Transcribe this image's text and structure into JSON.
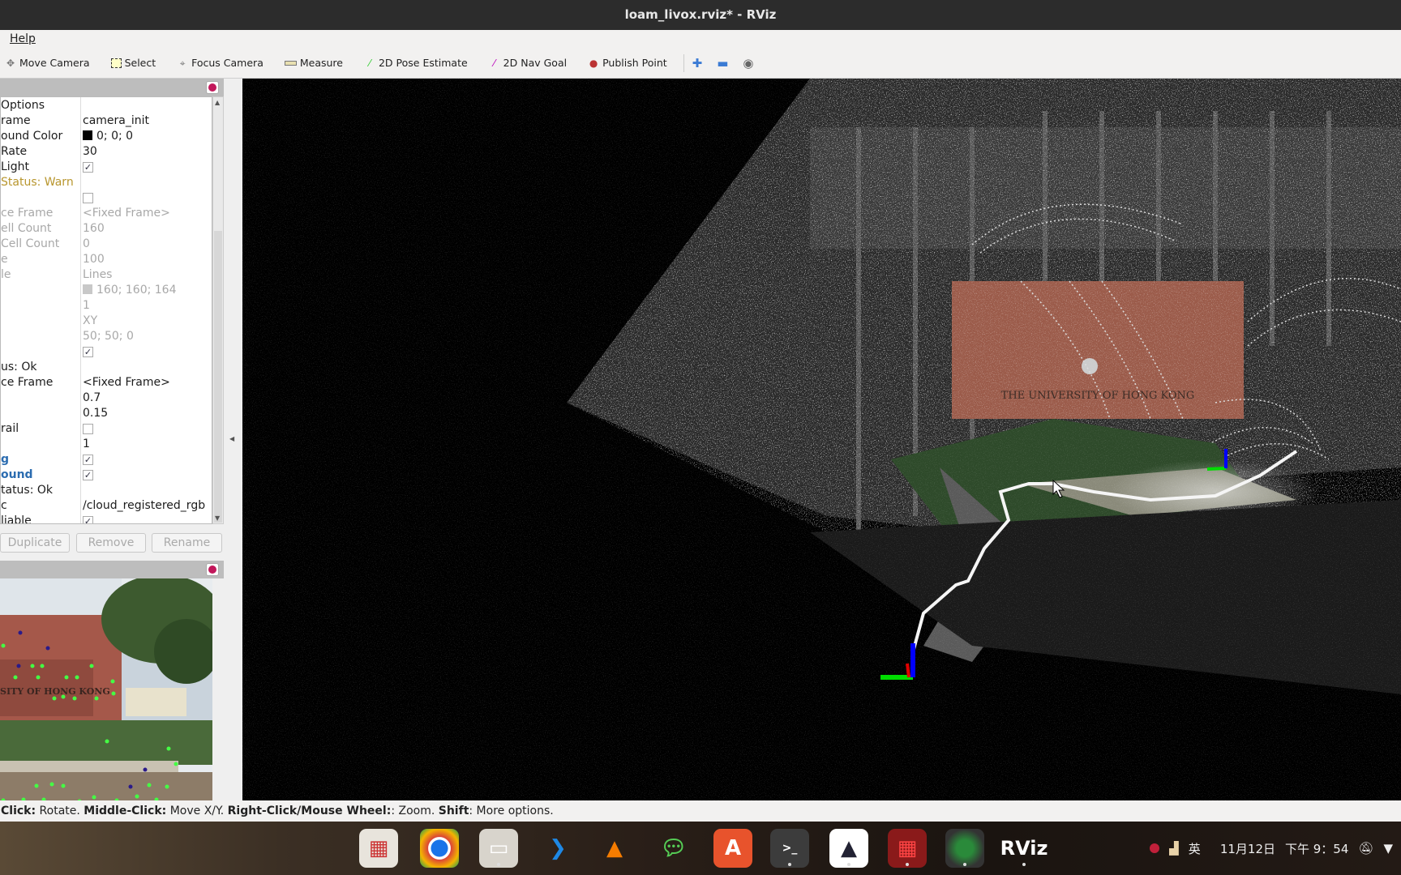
{
  "window": {
    "title": "loam_livox.rviz* - RViz"
  },
  "menu": {
    "help": "Help"
  },
  "toolbar": {
    "tools": [
      {
        "label": "Move Camera",
        "icon": "move-camera-icon"
      },
      {
        "label": "Select",
        "icon": "select-icon"
      },
      {
        "label": "Focus Camera",
        "icon": "focus-camera-icon"
      },
      {
        "label": "Measure",
        "icon": "ruler-icon"
      },
      {
        "label": "2D Pose Estimate",
        "icon": "green-arrow-icon"
      },
      {
        "label": "2D Nav Goal",
        "icon": "magenta-arrow-icon"
      },
      {
        "label": "Publish Point",
        "icon": "map-pin-icon"
      }
    ]
  },
  "displays": {
    "rows": [
      {
        "label": "Options",
        "type": "text",
        "value": ""
      },
      {
        "label": "rame",
        "type": "text",
        "value": "camera_init"
      },
      {
        "label": "ound Color",
        "type": "swatch",
        "value": "0; 0; 0",
        "color": "#000000"
      },
      {
        "label": "Rate",
        "type": "text",
        "value": "30"
      },
      {
        "label": " Light",
        "type": "check",
        "checked": true
      },
      {
        "label": "Status: Warn",
        "type": "text",
        "value": "",
        "style": "warn"
      },
      {
        "label": "",
        "type": "check",
        "checked": false
      },
      {
        "label": "ce Frame",
        "type": "text",
        "value": "<Fixed Frame>",
        "style": "dis"
      },
      {
        "label": "ell Count",
        "type": "text",
        "value": "160",
        "style": "dis"
      },
      {
        "label": " Cell Count",
        "type": "text",
        "value": "0",
        "style": "dis"
      },
      {
        "label": "e",
        "type": "text",
        "value": "100",
        "style": "dis"
      },
      {
        "label": "le",
        "type": "text",
        "value": "Lines",
        "style": "dis"
      },
      {
        "label": "",
        "type": "swatch",
        "value": "160; 160; 164",
        "color": "#c8c8c8",
        "style": "dis"
      },
      {
        "label": "",
        "type": "text",
        "value": "1",
        "style": "dis"
      },
      {
        "label": "",
        "type": "text",
        "value": "XY",
        "style": "dis"
      },
      {
        "label": "",
        "type": "text",
        "value": "50; 50; 0",
        "style": "dis"
      },
      {
        "label": "",
        "type": "check",
        "checked": true
      },
      {
        "label": "us: Ok",
        "type": "text",
        "value": ""
      },
      {
        "label": "ce Frame",
        "type": "text",
        "value": "<Fixed Frame>"
      },
      {
        "label": "",
        "type": "text",
        "value": "0.7"
      },
      {
        "label": "",
        "type": "text",
        "value": "0.15"
      },
      {
        "label": "rail",
        "type": "check",
        "checked": false
      },
      {
        "label": "",
        "type": "text",
        "value": "1"
      },
      {
        "label": "g",
        "type": "check",
        "checked": true,
        "style": "blue"
      },
      {
        "label": "ound",
        "type": "check",
        "checked": true,
        "style": "blue"
      },
      {
        "label": "tatus: Ok",
        "type": "text",
        "value": ""
      },
      {
        "label": "c",
        "type": "text",
        "value": "/cloud_registered_rgb"
      },
      {
        "label": "liable",
        "type": "check",
        "checked": true
      }
    ],
    "buttons": {
      "duplicate": "Duplicate",
      "remove": "Remove",
      "rename": "Rename"
    }
  },
  "image_panel": {
    "sign_text": "SITY OF HONG KONG"
  },
  "viewport": {
    "sign_text": "THE UNIVERSITY OF HONG KONG"
  },
  "status": {
    "k1": "Click:",
    "v1": " Rotate. ",
    "k2": "Middle-Click:",
    "v2": " Move X/Y. ",
    "k3": "Right-Click/Mouse Wheel:",
    "v3": ": Zoom. ",
    "k4": "Shift",
    "v4": ": More options."
  },
  "taskbar": {
    "apps": [
      {
        "name": "app-grid",
        "label": ""
      },
      {
        "name": "chrome",
        "label": ""
      },
      {
        "name": "files",
        "label": ""
      },
      {
        "name": "vscode",
        "label": ""
      },
      {
        "name": "vlc",
        "label": ""
      },
      {
        "name": "wechat",
        "label": ""
      },
      {
        "name": "app-store",
        "label": ""
      },
      {
        "name": "terminal",
        "label": ">_"
      },
      {
        "name": "cat-app",
        "label": ""
      },
      {
        "name": "rqt",
        "label": ""
      },
      {
        "name": "camera",
        "label": ""
      },
      {
        "name": "rviz",
        "label": "RViz"
      }
    ],
    "ime": "英",
    "date": "11月12日",
    "time": "下午 9：54"
  },
  "colors": {
    "warn": "#b8962e",
    "link": "#2b6cb0",
    "axis_x": "#e00000",
    "axis_y": "#00dd00",
    "axis_z": "#0000ff"
  }
}
